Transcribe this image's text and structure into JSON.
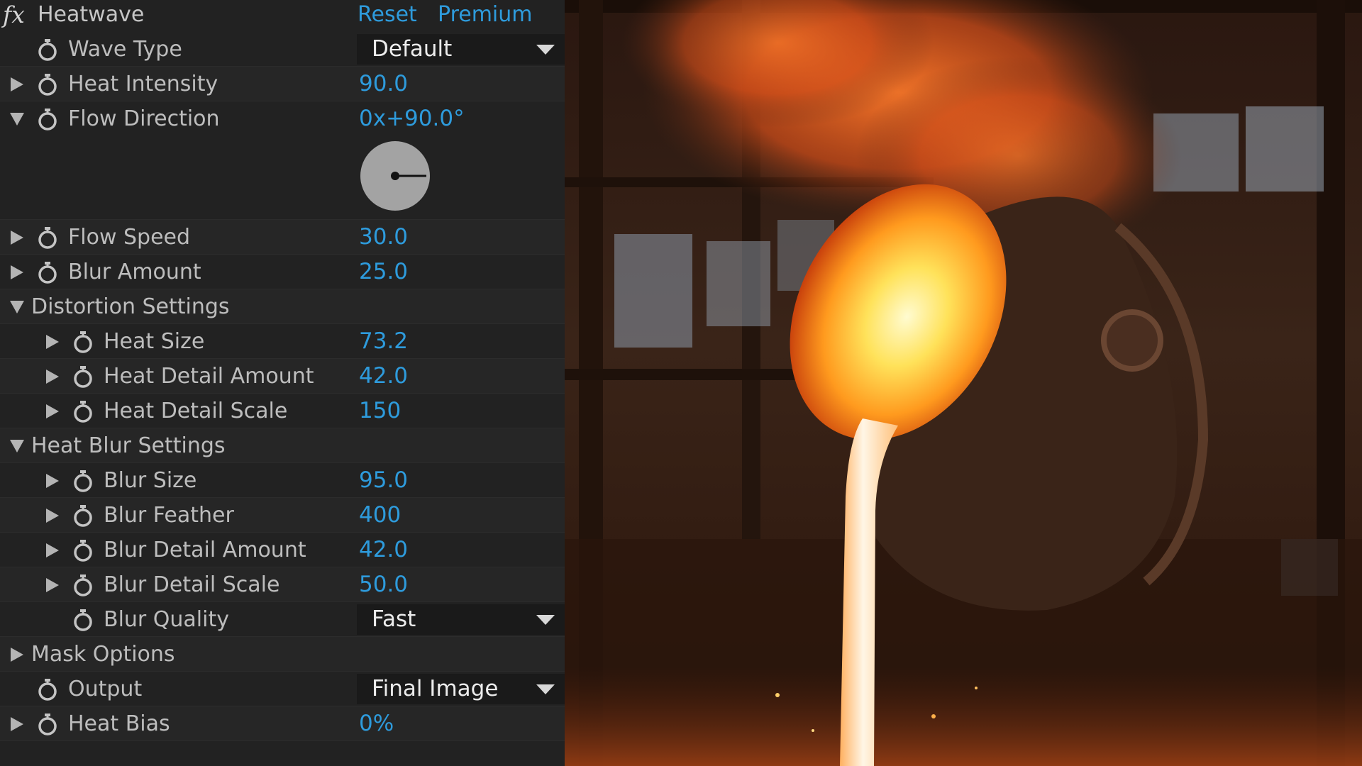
{
  "effect": {
    "name": "Heatwave",
    "fx_icon": "fx",
    "reset_label": "Reset",
    "premium_label": "Premium"
  },
  "params": {
    "wave_type": {
      "label": "Wave Type",
      "value": "Default"
    },
    "heat_intensity": {
      "label": "Heat Intensity",
      "value": "90.0"
    },
    "flow_direction": {
      "label": "Flow Direction",
      "value": "0x+90.0°",
      "dial_angle_degrees": 90
    },
    "flow_speed": {
      "label": "Flow Speed",
      "value": "30.0"
    },
    "blur_amount": {
      "label": "Blur Amount",
      "value": "25.0"
    },
    "distortion_settings": {
      "label": "Distortion Settings",
      "heat_size": {
        "label": "Heat Size",
        "value": "73.2"
      },
      "heat_detail_amount": {
        "label": "Heat Detail Amount",
        "value": "42.0"
      },
      "heat_detail_scale": {
        "label": "Heat Detail Scale",
        "value": "150"
      }
    },
    "heat_blur_settings": {
      "label": "Heat Blur Settings",
      "blur_size": {
        "label": "Blur Size",
        "value": "95.0"
      },
      "blur_feather": {
        "label": "Blur Feather",
        "value": "400"
      },
      "blur_detail_amount": {
        "label": "Blur Detail Amount",
        "value": "42.0"
      },
      "blur_detail_scale": {
        "label": "Blur Detail Scale",
        "value": "50.0"
      },
      "blur_quality": {
        "label": "Blur Quality",
        "value": "Fast"
      }
    },
    "mask_options": {
      "label": "Mask Options"
    },
    "output": {
      "label": "Output",
      "value": "Final Image"
    },
    "heat_bias": {
      "label": "Heat Bias",
      "value": "0%"
    }
  },
  "colors": {
    "accent_value": "#2e9bdc",
    "panel_background": "#222222",
    "label_text": "#bdbdbd"
  },
  "viewer": {
    "scene": "molten-metal-ladle-pour"
  }
}
